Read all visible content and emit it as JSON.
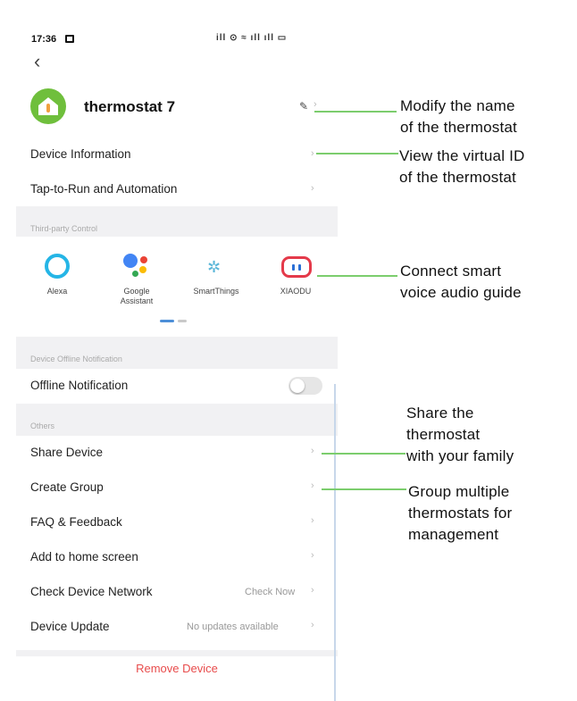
{
  "status_bar": {
    "time": "17:36",
    "icons": "ill ⊙ ≈ ıll ıll ▭"
  },
  "header": {
    "back_glyph": "‹"
  },
  "device": {
    "name": "thermostat 7",
    "edit_glyph": "✎",
    "chevron": "›"
  },
  "menu_top": [
    {
      "label": "Device Information",
      "chevron": "›"
    },
    {
      "label": "Tap-to-Run and Automation",
      "chevron": "›"
    }
  ],
  "third_party": {
    "section_label": "Third-party Control",
    "services": [
      {
        "label": "Alexa",
        "icon": "alexa-icon"
      },
      {
        "label": "Google\nAssistant",
        "icon": "google-assistant-icon"
      },
      {
        "label": "SmartThings",
        "icon": "smartthings-icon"
      },
      {
        "label": "XIAODU",
        "icon": "xiaodu-icon"
      }
    ],
    "smartthings_glyph": "✲"
  },
  "offline": {
    "section_label": "Device Offline Notification",
    "label": "Offline Notification",
    "enabled": false
  },
  "others": {
    "section_label": "Others",
    "items": [
      {
        "label": "Share Device",
        "right": "",
        "chevron": "›"
      },
      {
        "label": "Create Group",
        "right": "",
        "chevron": "›"
      },
      {
        "label": "FAQ & Feedback",
        "right": "",
        "chevron": "›"
      },
      {
        "label": "Add to home screen",
        "right": "",
        "chevron": "›"
      },
      {
        "label": "Check Device Network",
        "right": "Check Now",
        "chevron": "›"
      },
      {
        "label": "Device Update",
        "right": "No updates available",
        "chevron": "›"
      }
    ]
  },
  "remove_label": "Remove Device",
  "annotations": [
    {
      "text": "Modify the name\nof the thermostat"
    },
    {
      "text": "View the virtual ID\n of the thermostat"
    },
    {
      "text": "Connect smart\nvoice audio guide"
    },
    {
      "text": "Share the\nthermostat\nwith your family"
    },
    {
      "text": "Group multiple\nthermostats for\nmanagement"
    }
  ],
  "colors": {
    "accent_green": "#7ccd6d",
    "remove_red": "#e84c4c",
    "avatar_green": "#6fbf3c"
  }
}
